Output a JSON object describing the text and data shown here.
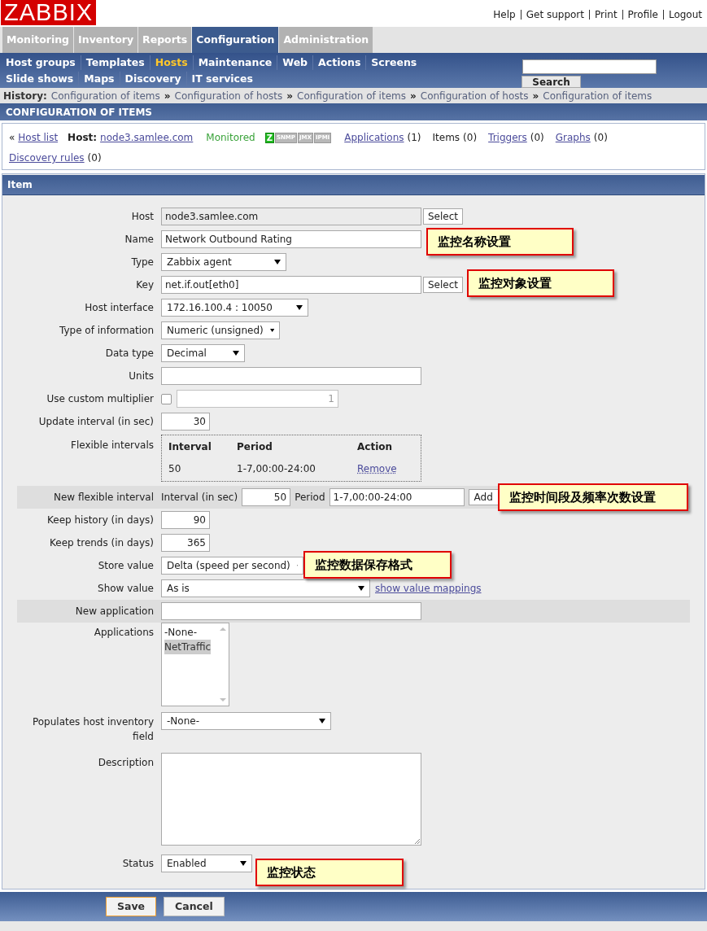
{
  "header": {
    "logo": "ZABBIX",
    "links": [
      "Help",
      "Get support",
      "Print",
      "Profile",
      "Logout"
    ]
  },
  "main_menu": [
    {
      "label": "Monitoring",
      "selected": false
    },
    {
      "label": "Inventory",
      "selected": false
    },
    {
      "label": "Reports",
      "selected": false
    },
    {
      "label": "Configuration",
      "selected": true
    },
    {
      "label": "Administration",
      "selected": false
    }
  ],
  "sub_menu": [
    {
      "items": [
        {
          "label": "Host groups",
          "selected": false
        },
        {
          "label": "Templates",
          "selected": false
        },
        {
          "label": "Hosts",
          "selected": true
        },
        {
          "label": "Maintenance",
          "selected": false
        },
        {
          "label": "Web",
          "selected": false
        },
        {
          "label": "Actions",
          "selected": false
        },
        {
          "label": "Screens",
          "selected": false
        }
      ]
    },
    {
      "items": [
        {
          "label": "Slide shows",
          "selected": false
        },
        {
          "label": "Maps",
          "selected": false
        },
        {
          "label": "Discovery",
          "selected": false
        },
        {
          "label": "IT services",
          "selected": false
        }
      ]
    }
  ],
  "search": {
    "button": "Search"
  },
  "history": {
    "label": "History:",
    "separator": "»",
    "items": [
      "Configuration of items",
      "Configuration of hosts",
      "Configuration of items",
      "Configuration of hosts",
      "Configuration of items"
    ]
  },
  "page_title": "CONFIGURATION OF ITEMS",
  "host_bar": {
    "back": "«",
    "host_list": "Host list",
    "host_label": "Host:",
    "host": "node3.samlee.com",
    "status": "Monitored",
    "availability": [
      {
        "label": "Z",
        "on": true
      },
      {
        "label": "SNMP",
        "on": false
      },
      {
        "label": "JMX",
        "on": false
      },
      {
        "label": "IPMI",
        "on": false
      }
    ],
    "links": [
      {
        "label": "Applications",
        "count": "(1)",
        "link": true
      },
      {
        "label": "Items",
        "count": "(0)",
        "link": false
      },
      {
        "label": "Triggers",
        "count": "(0)",
        "link": true
      },
      {
        "label": "Graphs",
        "count": "(0)",
        "link": true
      },
      {
        "label": "Discovery rules",
        "count": "(0)",
        "link": true
      }
    ]
  },
  "form": {
    "title": "Item",
    "rows": [
      {
        "kind": "input",
        "label": "Host",
        "value": "node3.samlee.com",
        "readonly": true,
        "button": "Select"
      },
      {
        "kind": "input",
        "label": "Name",
        "value": "Network Outbound Rating",
        "readonly": false
      },
      {
        "kind": "select",
        "label": "Type",
        "value": "Zabbix agent"
      },
      {
        "kind": "input",
        "label": "Key",
        "value": "net.if.out[eth0]",
        "readonly": false,
        "button": "Select"
      },
      {
        "kind": "select",
        "label": "Host interface",
        "value": "172.16.100.4 : 10050"
      },
      {
        "kind": "select",
        "label": "Type of information",
        "value": "Numeric (unsigned)"
      },
      {
        "kind": "select",
        "label": "Data type",
        "value": "Decimal"
      },
      {
        "kind": "input",
        "label": "Units",
        "readonly": false
      },
      {
        "kind": "checkbox_number",
        "label": "Use custom multiplier",
        "checked": false,
        "value": "1",
        "disabled": true
      },
      {
        "kind": "number",
        "label": "Update interval (in sec)",
        "value": "30"
      },
      {
        "kind": "flex_table",
        "label": "Flexible intervals",
        "columns": [
          "Interval",
          "Period",
          "Action"
        ],
        "rows": [
          {
            "interval": "50",
            "period": "1-7,00:00-24:00",
            "action": "Remove"
          }
        ]
      },
      {
        "kind": "new_flex",
        "label": "New flexible interval",
        "shaded": true,
        "interval_label": "Interval (in sec)",
        "interval": "50",
        "period_label": "Period",
        "period": "1-7,00:00-24:00",
        "button": "Add"
      },
      {
        "kind": "number",
        "label": "Keep history (in days)",
        "value": "90"
      },
      {
        "kind": "number",
        "label": "Keep trends (in days)",
        "value": "365"
      },
      {
        "kind": "select",
        "label": "Store value",
        "value": "Delta (speed per second)"
      },
      {
        "kind": "select",
        "label": "Show value",
        "value": "As is",
        "link": "show value mappings"
      },
      {
        "kind": "input",
        "label": "New application",
        "readonly": false,
        "shaded": true
      },
      {
        "kind": "listbox",
        "label": "Applications",
        "options": [
          {
            "label": "-None-",
            "selected": false
          },
          {
            "label": "NetTraffic",
            "selected": true
          }
        ]
      },
      {
        "kind": "select",
        "label": "Populates host inventory field",
        "value": "-None-"
      },
      {
        "kind": "textarea",
        "label": "Description"
      },
      {
        "kind": "select",
        "label": "Status",
        "value": "Enabled"
      }
    ]
  },
  "buttons": [
    {
      "label": "Save",
      "primary": true
    },
    {
      "label": "Cancel",
      "primary": false
    }
  ],
  "callouts": [
    {
      "text": "监控名称设置"
    },
    {
      "text": "监控对象设置"
    },
    {
      "text": "监控时间段及频率次数设置"
    },
    {
      "text": "监控数据保存格式"
    },
    {
      "text": "监控状态"
    }
  ]
}
